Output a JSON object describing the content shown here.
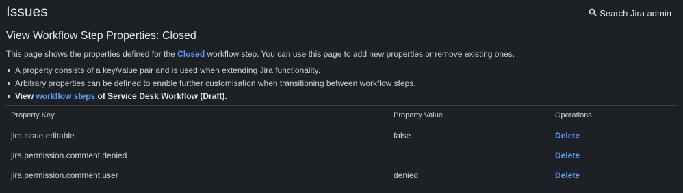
{
  "header": {
    "title": "Issues",
    "search_label": "Search Jira admin"
  },
  "section": {
    "title": "View Workflow Step Properties: Closed"
  },
  "intro": {
    "prefix": "This page shows the properties defined for the ",
    "step_link": "Closed",
    "suffix": " workflow step. You can use this page to add new properties or remove existing ones."
  },
  "bullets": {
    "item1": "A property consists of a key/value pair and is used when extending Jira functionality.",
    "item2": "Arbitrary properties can be defined to enable further customisation when transitioning between workflow steps.",
    "item3_prefix": "View ",
    "item3_link": "workflow steps",
    "item3_suffix": " of Service Desk Workflow (Draft)."
  },
  "table": {
    "headers": {
      "key": "Property Key",
      "value": "Property Value",
      "operations": "Operations"
    },
    "rows": [
      {
        "key": "jira.issue.editable",
        "value": "false",
        "operation": "Delete"
      },
      {
        "key": "jira.permission.comment.denied",
        "value": "",
        "operation": "Delete"
      },
      {
        "key": "jira.permission.comment.user",
        "value": "denied",
        "operation": "Delete"
      }
    ]
  },
  "colors": {
    "background": "#1d2125",
    "link": "#579dff",
    "text": "#c7d1db"
  }
}
